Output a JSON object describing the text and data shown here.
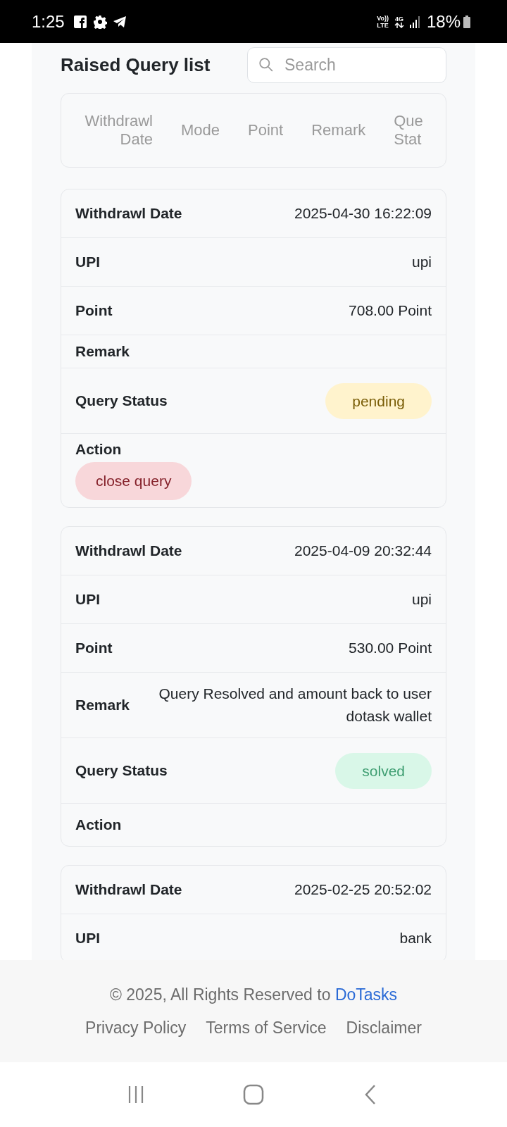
{
  "status_bar": {
    "time": "1:25",
    "volte": [
      "Vo))",
      "LTE"
    ],
    "data": "4G",
    "battery": "18%"
  },
  "page": {
    "title": "Raised Query list",
    "search": {
      "placeholder": "Search"
    }
  },
  "table": {
    "columns": [
      "Withdrawl Date",
      "Mode",
      "Point",
      "Remark",
      "Que Stat"
    ]
  },
  "cards": [
    {
      "rows": [
        {
          "kind": "text",
          "label": "Withdrawl Date",
          "value": "2025-04-30 16:22:09"
        },
        {
          "kind": "text",
          "label": "UPI",
          "value": "upi"
        },
        {
          "kind": "text",
          "label": "Point",
          "value": "708.00 Point"
        },
        {
          "kind": "text",
          "label": "Remark"
        },
        {
          "kind": "status",
          "label": "Query Status",
          "value": "pending"
        },
        {
          "kind": "action",
          "label": "Action",
          "button": "close query"
        }
      ]
    },
    {
      "rows": [
        {
          "kind": "text",
          "label": "Withdrawl Date",
          "value": "2025-04-09 20:32:44"
        },
        {
          "kind": "text",
          "label": "UPI",
          "value": "upi"
        },
        {
          "kind": "text",
          "label": "Point",
          "value": "530.00 Point"
        },
        {
          "kind": "text",
          "label": "Remark",
          "value": "Query Resolved and amount back to user dotask wallet"
        },
        {
          "kind": "status",
          "label": "Query Status",
          "value": "solved"
        },
        {
          "kind": "action",
          "label": "Action"
        }
      ]
    },
    {
      "rows": [
        {
          "kind": "text",
          "label": "Withdrawl Date",
          "value": "2025-02-25 20:52:02"
        },
        {
          "kind": "text",
          "label": "UPI",
          "value": "bank"
        }
      ]
    }
  ],
  "footer": {
    "copyright": "© 2025, All Rights Reserved to",
    "brand": "DoTasks",
    "links": [
      "Privacy Policy",
      "Terms of Service",
      "Disclaimer"
    ]
  }
}
